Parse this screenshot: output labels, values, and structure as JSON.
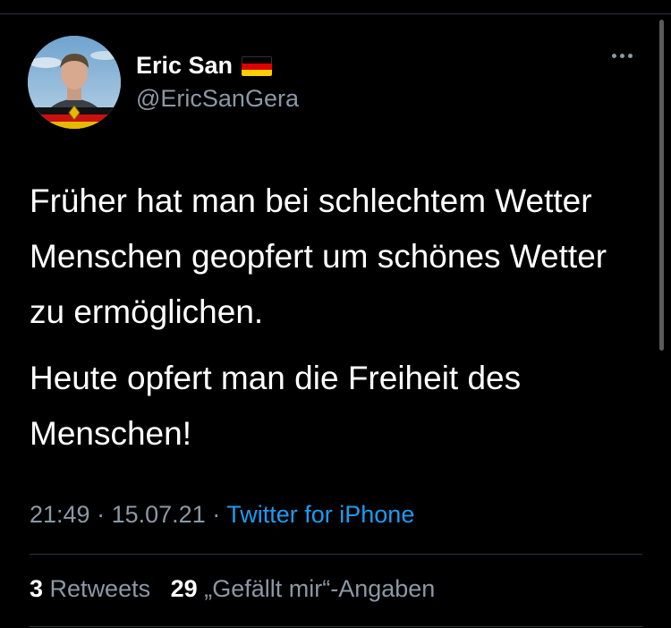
{
  "user": {
    "display_name": "Eric San",
    "handle": "@EricSanGera",
    "flag_icon": "germany-flag-icon"
  },
  "tweet": {
    "paragraphs": [
      "Früher hat man bei schlechtem Wetter Menschen geopfert um schönes Wetter zu ermöglichen.",
      "Heute opfert man die Freiheit des Menschen!"
    ],
    "time": "21:49",
    "date": "15.07.21",
    "separator": "·",
    "source": "Twitter for iPhone"
  },
  "stats": {
    "retweets_count": "3",
    "retweets_label": "Retweets",
    "likes_count": "29",
    "likes_label": "„Gefällt mir“-Angaben"
  },
  "colors": {
    "background": "#000000",
    "text": "#ffffff",
    "secondary": "#8b98a5",
    "link": "#1d9bf0",
    "divider": "#2f3336"
  }
}
